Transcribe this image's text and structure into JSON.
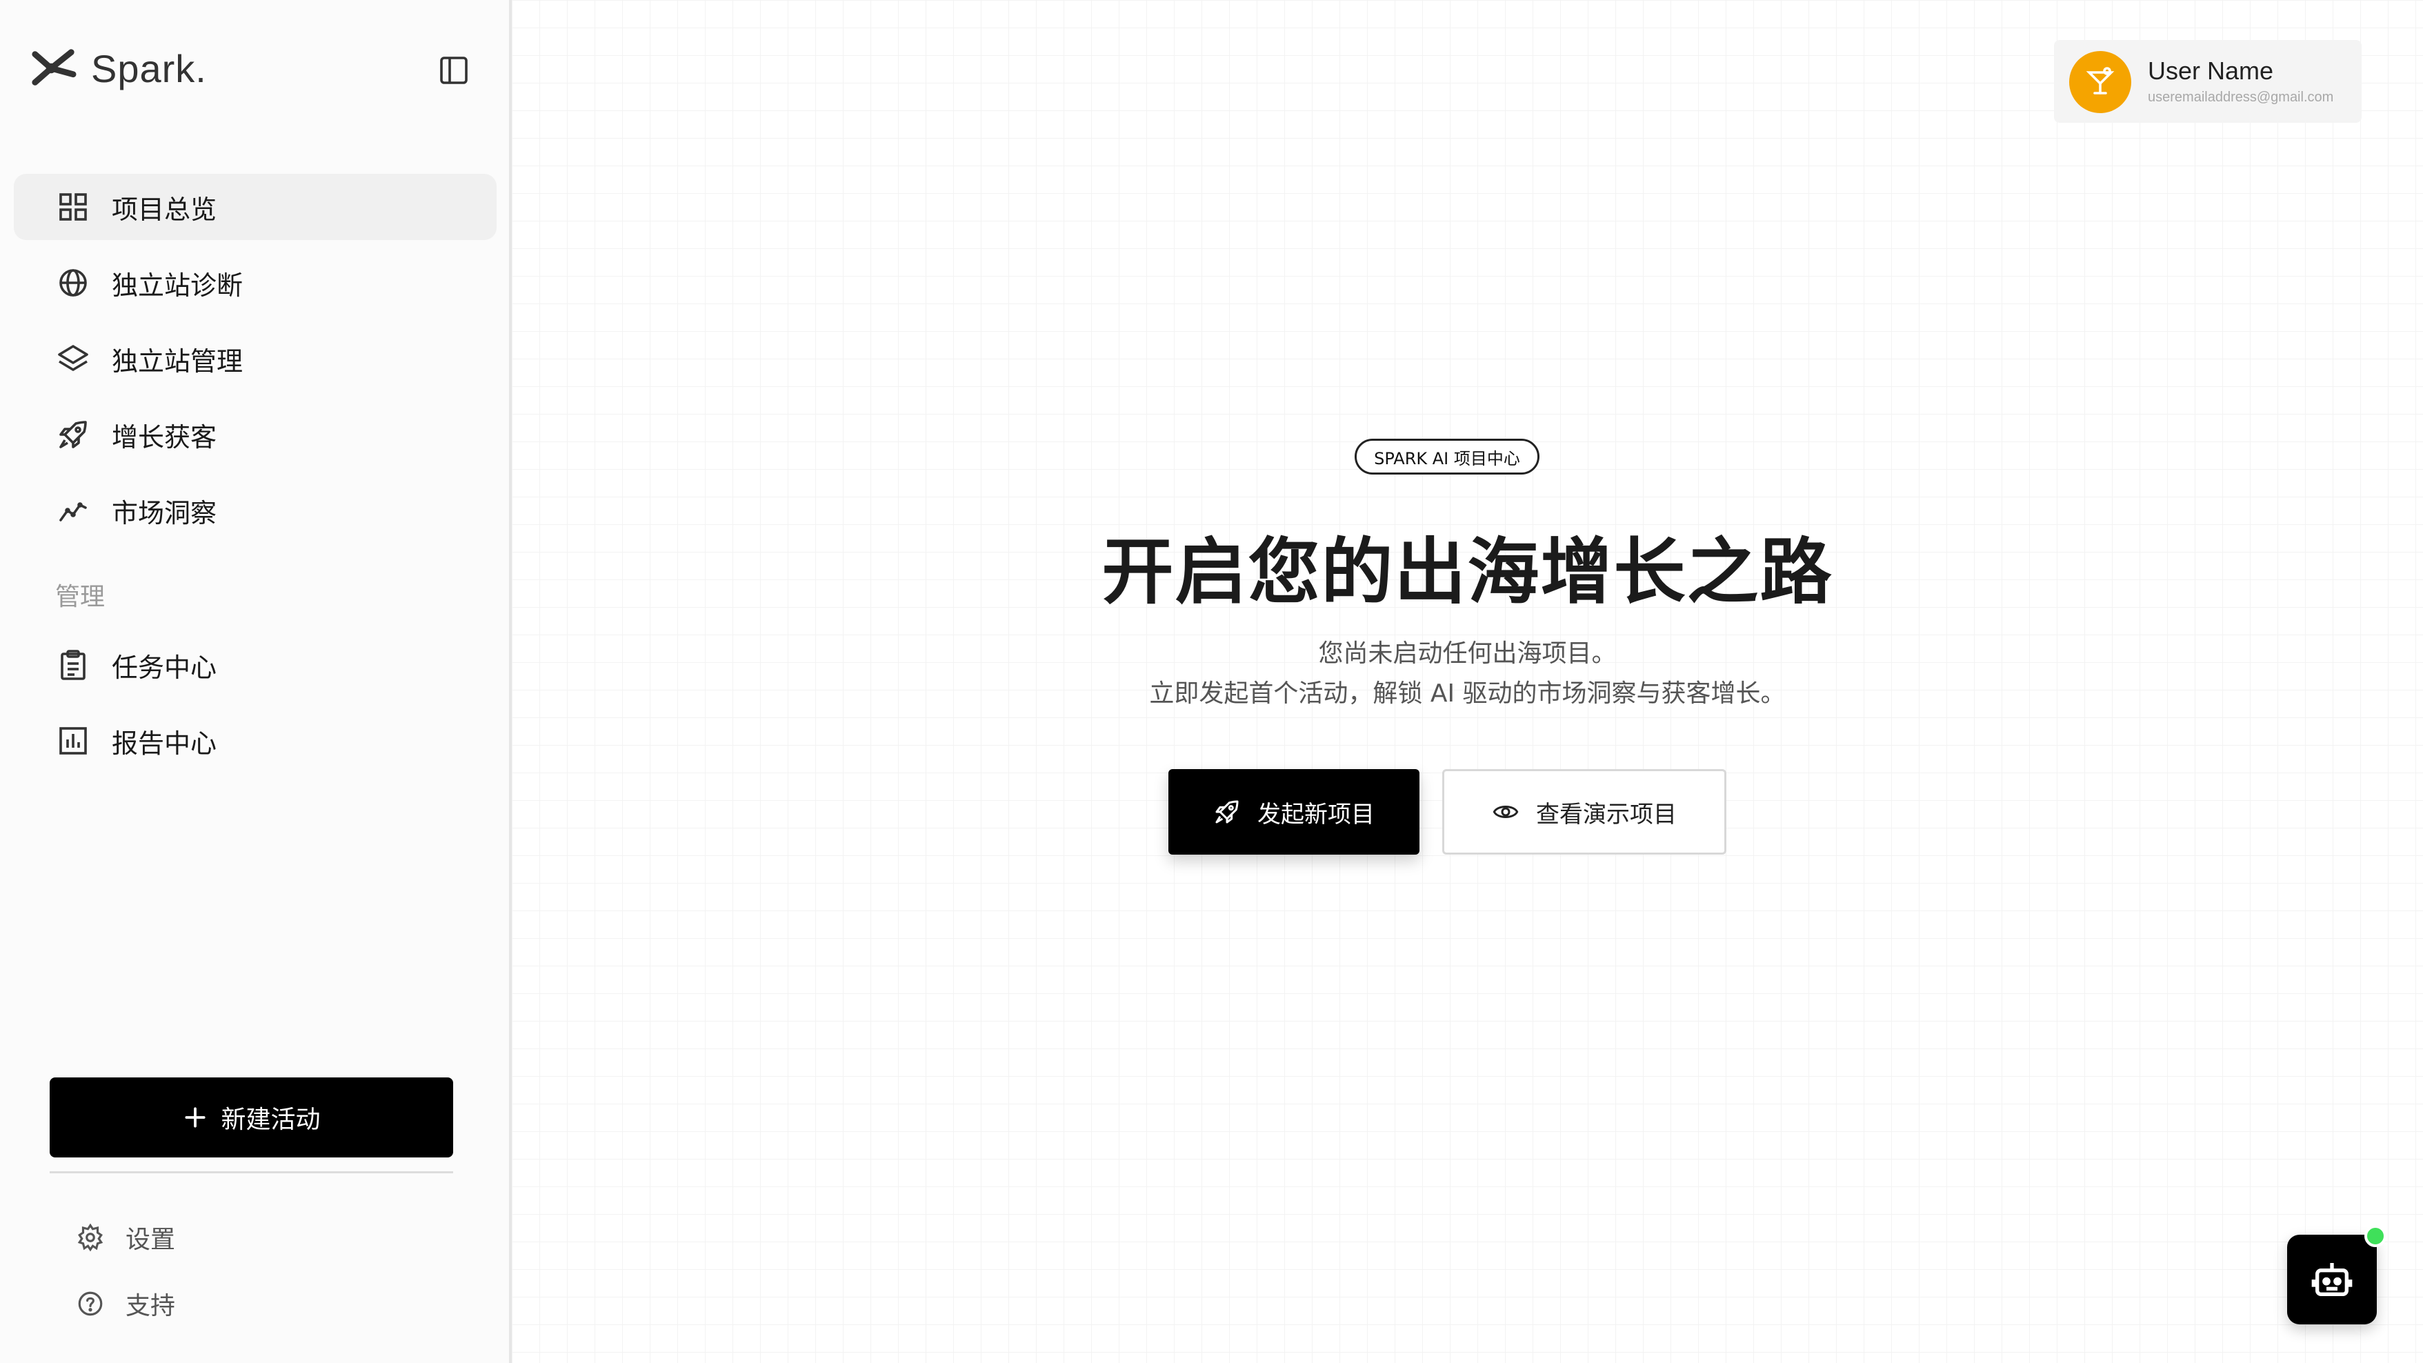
{
  "brand": {
    "name": "Spark.",
    "logo_icon": "spark-logo-icon",
    "collapse_icon": "sidebar-toggle-icon"
  },
  "sidebar": {
    "items": [
      {
        "label": "项目总览",
        "icon": "grid-icon",
        "active": true
      },
      {
        "label": "独立站诊断",
        "icon": "globe-icon",
        "active": false
      },
      {
        "label": "独立站管理",
        "icon": "layers-icon",
        "active": false
      },
      {
        "label": "增长获客",
        "icon": "rocket-icon",
        "active": false
      },
      {
        "label": "市场洞察",
        "icon": "trend-icon",
        "active": false
      }
    ],
    "section_label": "管理",
    "manage_items": [
      {
        "label": "任务中心",
        "icon": "clipboard-icon"
      },
      {
        "label": "报告中心",
        "icon": "bar-chart-icon"
      }
    ],
    "new_button": "新建活动",
    "footer": [
      {
        "label": "设置",
        "icon": "gear-icon"
      },
      {
        "label": "支持",
        "icon": "help-icon"
      }
    ]
  },
  "user": {
    "name": "User Name",
    "email": "useremailaddress@gmail.com",
    "avatar_color": "#F5A400"
  },
  "hero": {
    "badge": "SPARK AI 项目中心",
    "title": "开启您的出海增长之路",
    "subtitle_line1": "您尚未启动任何出海项目。",
    "subtitle_line2": "立即发起首个活动，解锁 AI 驱动的市场洞察与获客增长。",
    "primary_button": "发起新项目",
    "secondary_button": "查看演示项目"
  },
  "assistant": {
    "icon": "robot-icon",
    "status_color": "#3FE05A"
  }
}
